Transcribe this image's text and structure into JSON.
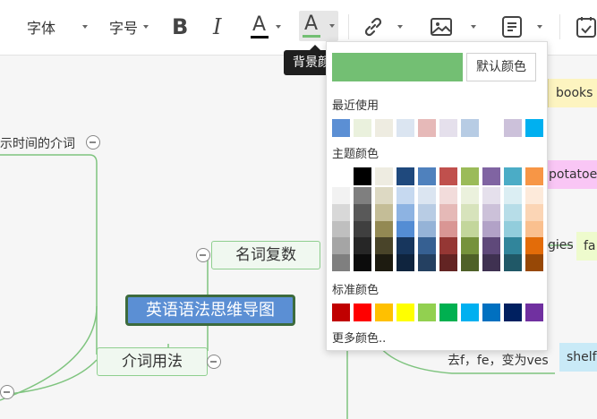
{
  "toolbar": {
    "font_label": "字体",
    "size_label": "字号",
    "bold_glyph": "B",
    "italic_glyph": "I",
    "font_color_glyph": "A",
    "bg_color_glyph": "A"
  },
  "tooltip": "背景颜色",
  "color_picker": {
    "current_color": "#73bf73",
    "default_button": "默认颜色",
    "recent_label": "最近使用",
    "recent_colors": [
      "#5b8fd4",
      "#eaf1dd",
      "#eeece1",
      "#dbe5f1",
      "#e6b9b8",
      "#e5e0ec",
      "#b7cce4",
      "#ffffff",
      "#ccc1da",
      "#00b0f0"
    ],
    "theme_label": "主题颜色",
    "theme_top": [
      "#ffffff",
      "#000000",
      "#eeece1",
      "#1f497d",
      "#4f81bd",
      "#c0504d",
      "#9bbb59",
      "#8064a2",
      "#4bacc6",
      "#f79646"
    ],
    "theme_shades": [
      [
        "#f2f2f2",
        "#d8d8d8",
        "#bfbfbf",
        "#a5a5a5",
        "#7f7f7f"
      ],
      [
        "#7f7f7f",
        "#595959",
        "#3f3f3f",
        "#262626",
        "#0c0c0c"
      ],
      [
        "#ddd9c3",
        "#c4bd97",
        "#938953",
        "#494429",
        "#1d1b10"
      ],
      [
        "#c6d9f0",
        "#8db3e2",
        "#548dd4",
        "#17365d",
        "#0f243e"
      ],
      [
        "#dbe5f1",
        "#b8cce4",
        "#95b3d7",
        "#366092",
        "#244061"
      ],
      [
        "#f2dcdb",
        "#e5b9b7",
        "#d99694",
        "#953734",
        "#632423"
      ],
      [
        "#ebf1dd",
        "#d7e3bc",
        "#c3d69b",
        "#76923c",
        "#4f6128"
      ],
      [
        "#e5e0ec",
        "#ccc1d9",
        "#b2a2c7",
        "#5f497a",
        "#3f3151"
      ],
      [
        "#dbeef3",
        "#b7dde8",
        "#92cddc",
        "#31859b",
        "#205867"
      ],
      [
        "#fdeada",
        "#fbd5b5",
        "#fac08f",
        "#e36c09",
        "#974806"
      ]
    ],
    "standard_label": "标准颜色",
    "standard_colors": [
      "#c00000",
      "#ff0000",
      "#ffc000",
      "#ffff00",
      "#92d050",
      "#00b050",
      "#00b0f0",
      "#0070c0",
      "#002060",
      "#7030a0"
    ],
    "more_colors": "更多颜色.."
  },
  "mindmap": {
    "root": "英语语法思维导图",
    "node_plural": "名词复数",
    "node_preposition": "介词用法",
    "branch_time_prep": "示时间的介词",
    "leaf_books": "books",
    "leaf_potatoes": "potatoes",
    "leaf_gies": "gies",
    "leaf_fa": "fa",
    "leaf_rule_fe": "去f，fe，变为ves",
    "leaf_shelf": "shelf",
    "colors": {
      "line": "#7fc47f",
      "root_bg": "#5b8fd4",
      "root_border": "#3d6b3d",
      "pill_yellow": "#fdf4c0",
      "pill_pink": "#f9c6f5",
      "pill_lime": "#eefbcd",
      "pill_blue": "#c9eaf7"
    }
  }
}
